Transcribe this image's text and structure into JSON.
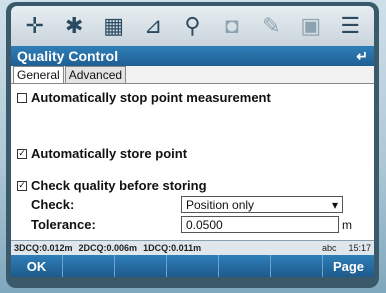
{
  "toolbar": {
    "icons": [
      "crosshair-icon",
      "tools-icon",
      "calculator-icon",
      "survey-icon",
      "antenna-icon",
      "camera-icon",
      "edit-icon",
      "map-icon",
      "list-icon"
    ]
  },
  "window": {
    "title": "Quality Control",
    "back_glyph": "↵"
  },
  "tabs": [
    {
      "label": "General",
      "active": true
    },
    {
      "label": "Advanced",
      "active": false
    }
  ],
  "options": {
    "stop_measurement": {
      "label": "Automatically stop point measurement",
      "checked": false
    },
    "store_point": {
      "label": "Automatically store point",
      "checked": true
    },
    "check_quality": {
      "label": "Check quality before storing",
      "checked": true
    }
  },
  "fields": {
    "check": {
      "label": "Check:",
      "value": "Position only"
    },
    "tolerance": {
      "label": "Tolerance:",
      "value": "0.0500",
      "unit": "m"
    }
  },
  "status": {
    "dcq3": "3DCQ:0.012m",
    "dcq2": "2DCQ:0.006m",
    "dcq1": "1DCQ:0.011m",
    "input_mode": "abc",
    "time": "15:17"
  },
  "softkeys": [
    "OK",
    "",
    "",
    "",
    "",
    "",
    "Page"
  ]
}
